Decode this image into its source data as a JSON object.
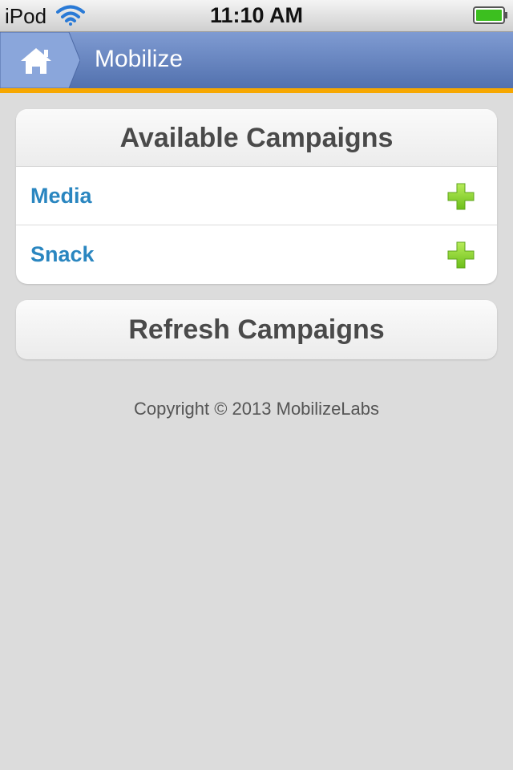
{
  "status_bar": {
    "carrier": "iPod",
    "time": "11:10 AM",
    "wifi_icon": "wifi-icon",
    "battery_icon": "battery-icon",
    "battery_color": "#3cbf1f"
  },
  "header": {
    "title": "Mobilize",
    "home_icon": "home-icon",
    "accent_color": "#f6a700",
    "bar_color": "#5f7fbe"
  },
  "campaigns": {
    "heading": "Available Campaigns",
    "items": [
      {
        "label": "Media",
        "action_icon": "plus-icon"
      },
      {
        "label": "Snack",
        "action_icon": "plus-icon"
      }
    ]
  },
  "refresh_label": "Refresh Campaigns",
  "footer": {
    "copyright": "Copyright © 2013 MobilizeLabs"
  }
}
